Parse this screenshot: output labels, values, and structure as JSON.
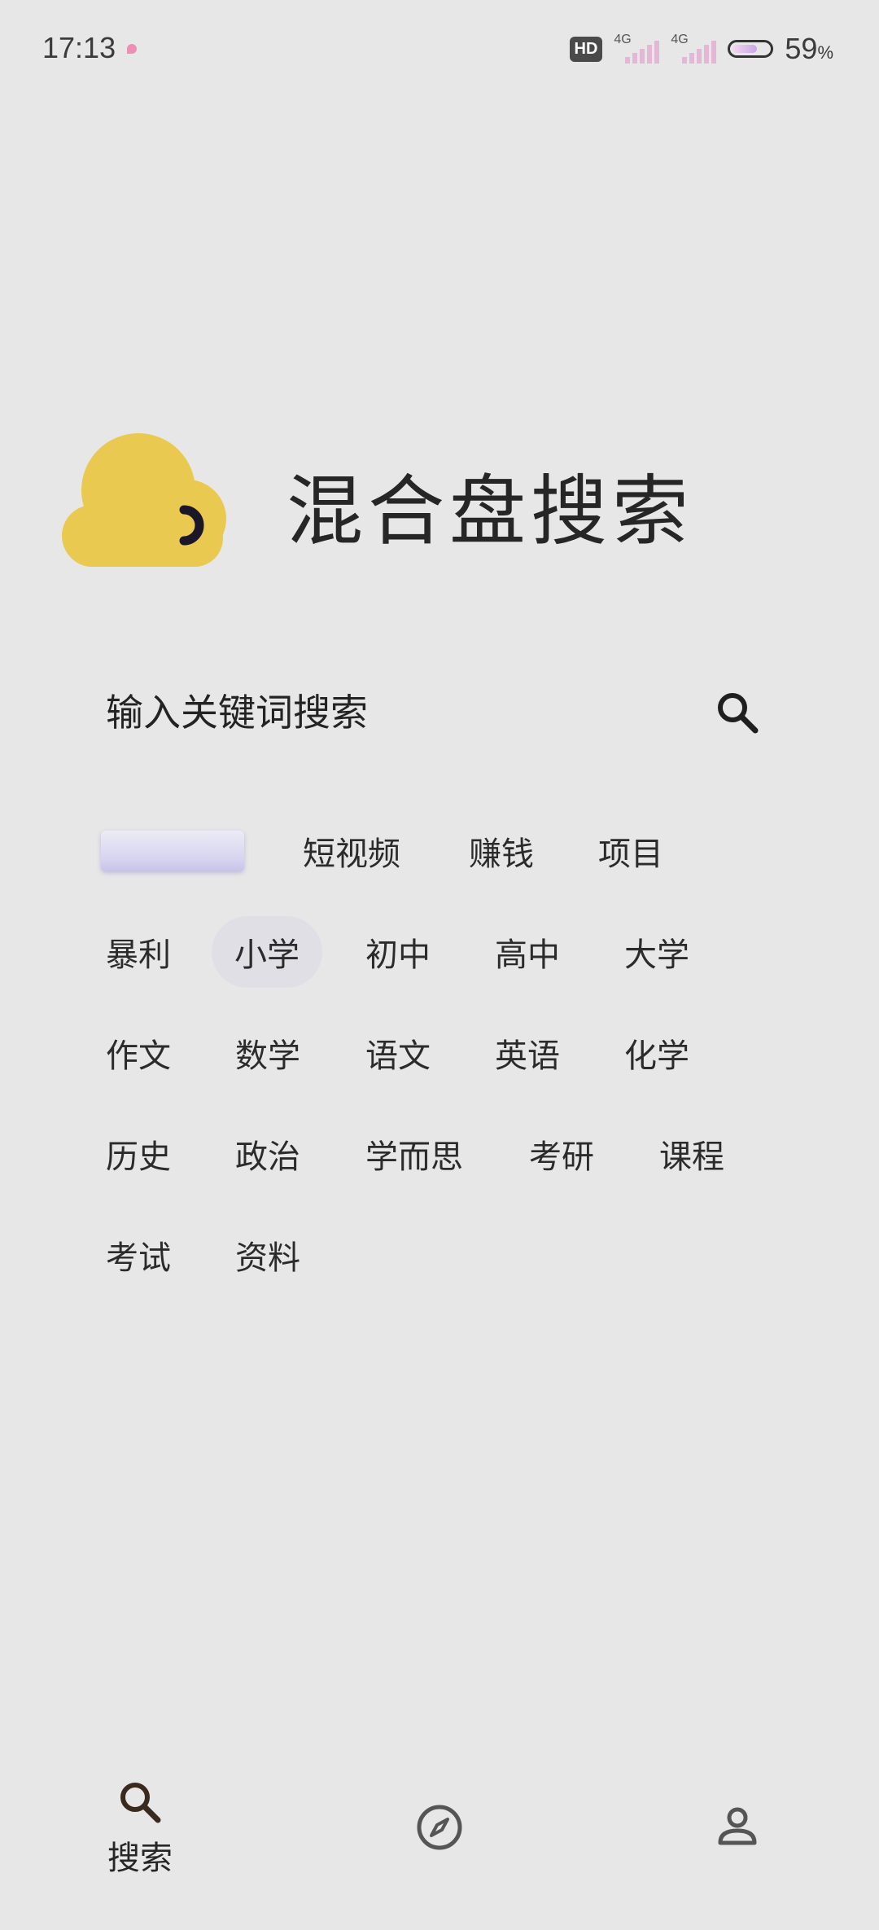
{
  "status_bar": {
    "time": "17:13",
    "hd_label": "HD",
    "net1_label": "4G",
    "net2_label": "4G",
    "battery_percent": "59",
    "battery_unit": "%"
  },
  "header": {
    "title": "混合盘搜索",
    "logo_icon": "cloud-logo-icon",
    "logo_color": "#e9c94f"
  },
  "search": {
    "placeholder": "输入关键词搜索",
    "value": "",
    "search_icon": "search-icon"
  },
  "tags": [
    "短视频",
    "赚钱",
    "项目",
    "暴利",
    "小学",
    "初中",
    "高中",
    "大学",
    "作文",
    "数学",
    "语文",
    "英语",
    "化学",
    "历史",
    "政治",
    "学而思",
    "考研",
    "课程",
    "考试",
    "资料"
  ],
  "bottom_nav": {
    "items": [
      {
        "label": "搜索",
        "icon": "search-icon",
        "active": true
      },
      {
        "label": "",
        "icon": "compass-icon",
        "active": false
      },
      {
        "label": "",
        "icon": "person-icon",
        "active": false
      }
    ]
  },
  "colors": {
    "background": "#e8e7e8",
    "text": "#262626",
    "highlight_chip": "#e0dfe6",
    "nav_active": "#3a2a1e"
  }
}
